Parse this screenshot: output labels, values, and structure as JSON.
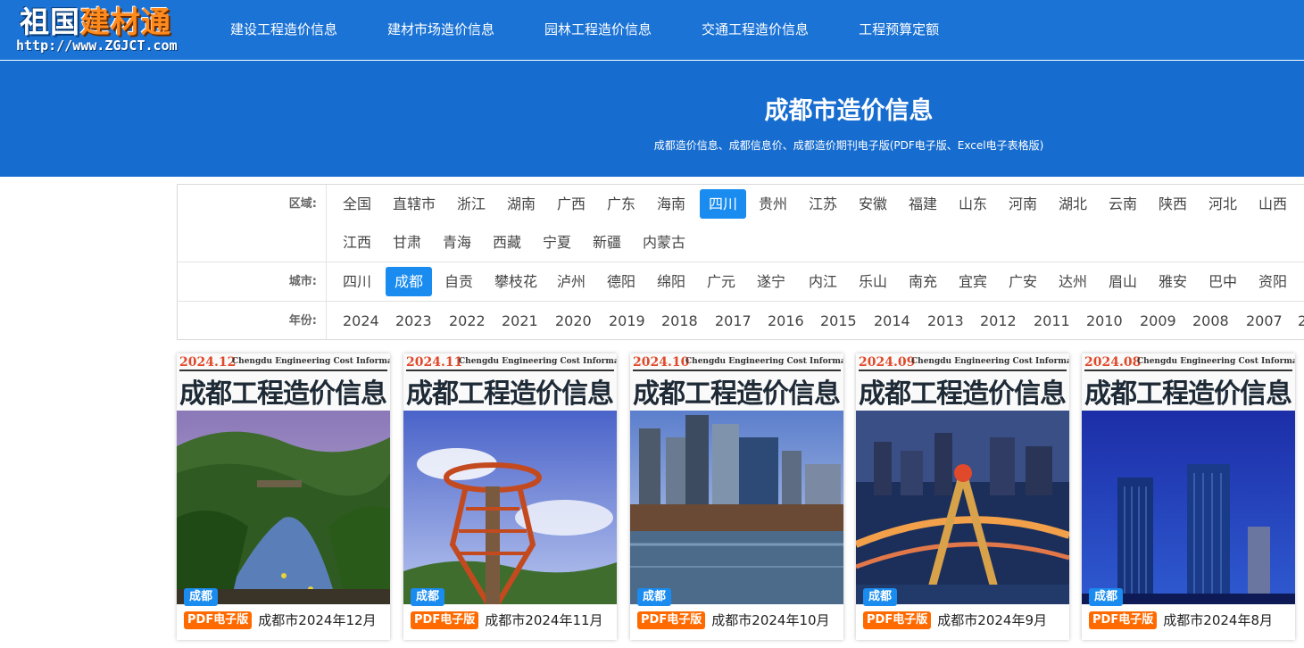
{
  "logo": {
    "part1": "祖国",
    "part2": "建材通",
    "url": "http://www.ZGJCT.com"
  },
  "nav": [
    "建设工程造价信息",
    "建材市场造价信息",
    "园林工程造价信息",
    "交通工程造价信息",
    "工程预算定额"
  ],
  "banner": {
    "title": "成都市造价信息",
    "subtitle": "成都造价信息、成都信息价、成都造价期刊电子版(PDF电子版、Excel电子表格版)"
  },
  "filters": {
    "region": {
      "label": "区域:",
      "active": "四川",
      "row1": [
        "全国",
        "直辖市",
        "浙江",
        "湖南",
        "广西",
        "广东",
        "海南",
        "四川",
        "贵州",
        "江苏",
        "安徽",
        "福建",
        "山东",
        "河南",
        "湖北",
        "云南",
        "陕西",
        "河北",
        "山西"
      ],
      "row2": [
        "江西",
        "甘肃",
        "青海",
        "西藏",
        "宁夏",
        "新疆",
        "内蒙古"
      ]
    },
    "city": {
      "label": "城市:",
      "active": "成都",
      "items": [
        "四川",
        "成都",
        "自贡",
        "攀枝花",
        "泸州",
        "德阳",
        "绵阳",
        "广元",
        "遂宁",
        "内江",
        "乐山",
        "南充",
        "宜宾",
        "广安",
        "达州",
        "眉山",
        "雅安",
        "巴中",
        "资阳"
      ]
    },
    "year": {
      "label": "年份:",
      "items": [
        "2024",
        "2023",
        "2022",
        "2021",
        "2020",
        "2019",
        "2018",
        "2017",
        "2016",
        "2015",
        "2014",
        "2013",
        "2012",
        "2011",
        "2010",
        "2009",
        "2008",
        "2007",
        "2"
      ]
    }
  },
  "cover": {
    "en": "Chengdu Engineering Cost Information",
    "cn": "成都工程造价信息"
  },
  "cards": [
    {
      "date": "2024.12",
      "city": "成都",
      "tag": "PDF电子版",
      "title": "成都市2024年12月"
    },
    {
      "date": "2024.11",
      "city": "成都",
      "tag": "PDF电子版",
      "title": "成都市2024年11月"
    },
    {
      "date": "2024.10",
      "city": "成都",
      "tag": "PDF电子版",
      "title": "成都市2024年10月"
    },
    {
      "date": "2024.09",
      "city": "成都",
      "tag": "PDF电子版",
      "title": "成都市2024年9月"
    },
    {
      "date": "2024.08",
      "city": "成都",
      "tag": "PDF电子版",
      "title": "成都市2024年8月"
    }
  ],
  "colors": {
    "nav_bg": "#1b73d6",
    "banner_bg": "#176dcf",
    "active": "#1a8cf0",
    "pdf_tag": "#ff6a00",
    "date_red": "#e04a2a"
  }
}
